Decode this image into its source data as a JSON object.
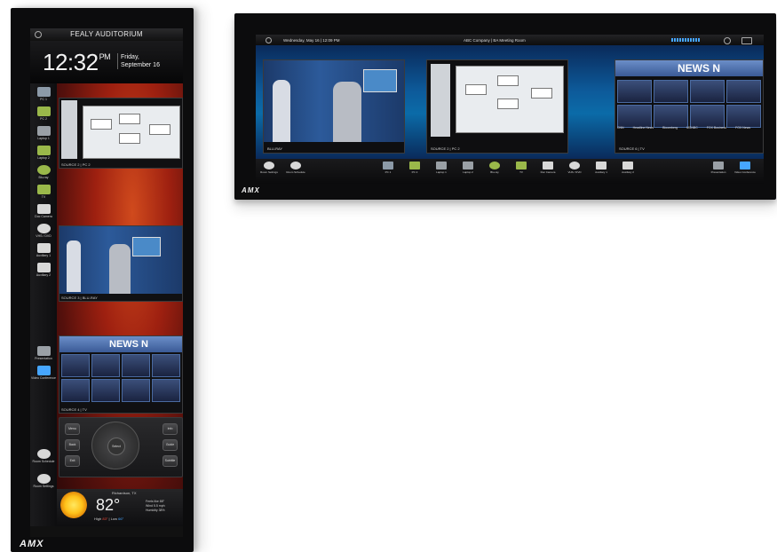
{
  "portrait": {
    "room_title": "FEALY AUDITORIUM",
    "time": "12:32",
    "ampm": "PM",
    "date_line1": "Friday,",
    "date_line2": "September 16",
    "sources": [
      {
        "label": "PC 1",
        "icon": "pc-icon",
        "color": "#8c9aa8"
      },
      {
        "label": "PC 2",
        "icon": "pc-icon",
        "color": "#9ab84a"
      },
      {
        "label": "Laptop 1",
        "icon": "laptop-icon",
        "color": "#9aa0a6"
      },
      {
        "label": "Laptop 2",
        "icon": "laptop-icon",
        "color": "#9ab84a"
      },
      {
        "label": "Blu-ray",
        "icon": "disc-icon",
        "color": "#9ab84a"
      },
      {
        "label": "TV",
        "icon": "tv-icon",
        "color": "#9ab84a"
      },
      {
        "label": "Doc Camera",
        "icon": "doc-camera-icon",
        "color": "#d8d8d8"
      },
      {
        "label": "VHS / DVD",
        "icon": "film-reel-icon",
        "color": "#d8d8d8"
      },
      {
        "label": "Auxiliary 1",
        "icon": "cable-icon",
        "color": "#d8d8d8"
      },
      {
        "label": "Auxiliary 2",
        "icon": "cable-icon",
        "color": "#d8d8d8"
      },
      {
        "label": "Presentation",
        "icon": "presentation-icon",
        "color": "#9aa0a6"
      },
      {
        "label": "Video Conference",
        "icon": "video-conference-icon",
        "color": "#46a6ff"
      },
      {
        "label": "Room Schedule",
        "icon": "schedule-icon",
        "color": "#d8d8d8"
      },
      {
        "label": "Room Settings",
        "icon": "gear-icon",
        "color": "#d8d8d8"
      }
    ],
    "tiles": [
      {
        "caption": "SOURCE 2  |  PC 2"
      },
      {
        "caption": "SOURCE 3  |  BLU-RAY"
      },
      {
        "caption": "SOURCE 4  |  TV"
      }
    ],
    "news_text": "NEWS N",
    "remote_buttons": [
      "Menu",
      "Back",
      "Exit",
      "Info",
      "Guide",
      "Subtitle",
      "Select"
    ],
    "weather": {
      "city": "Richardson, TX",
      "temp": "82°",
      "details": [
        "Feels like   88°",
        "Wind         5.5 mph",
        "Humidity     38%"
      ],
      "high_label": "High",
      "high": "83°",
      "low_label": "Low",
      "low": "66°"
    },
    "logo": "AMX"
  },
  "landscape": {
    "date": "Wednesday, May 16  |  12:09 PM",
    "room": "ABC Company  |  BA Meeting Room",
    "tiles": [
      {
        "caption": "BLU-RAY"
      },
      {
        "caption": "SOURCE 2  |  PC 2"
      },
      {
        "caption": "SOURCE 6  |  TV"
      }
    ],
    "news_text": "NEWS N",
    "news_channels": [
      "CNN",
      "Headline News",
      "Bloomberg",
      "MSNBC",
      "FOX Business",
      "FOX News"
    ],
    "left_buttons": [
      {
        "label": "Room Settings",
        "icon": "gear-icon"
      },
      {
        "label": "Room Schedule",
        "icon": "schedule-icon"
      }
    ],
    "sources": [
      {
        "label": "PC 1",
        "icon": "pc-icon",
        "color": "#8c9aa8"
      },
      {
        "label": "PC 2",
        "icon": "pc-icon",
        "color": "#9ab84a"
      },
      {
        "label": "Laptop 1",
        "icon": "laptop-icon",
        "color": "#9aa0a6"
      },
      {
        "label": "Laptop 2",
        "icon": "laptop-icon",
        "color": "#9aa0a6"
      },
      {
        "label": "Blu-ray",
        "icon": "disc-icon",
        "color": "#9ab84a"
      },
      {
        "label": "TV",
        "icon": "tv-icon",
        "color": "#9ab84a"
      },
      {
        "label": "Doc Camera",
        "icon": "doc-camera-icon",
        "color": "#d8d8d8"
      },
      {
        "label": "VHS / DVD",
        "icon": "film-reel-icon",
        "color": "#d8d8d8"
      },
      {
        "label": "Auxiliary 1",
        "icon": "cable-icon",
        "color": "#d8d8d8"
      },
      {
        "label": "Auxiliary 2",
        "icon": "cable-icon",
        "color": "#d8d8d8"
      }
    ],
    "right_buttons": [
      {
        "label": "Presentation",
        "icon": "presentation-icon",
        "color": "#9aa0a6"
      },
      {
        "label": "Video Conference",
        "icon": "video-conference-icon",
        "color": "#46a6ff"
      }
    ],
    "logo": "AMX"
  }
}
